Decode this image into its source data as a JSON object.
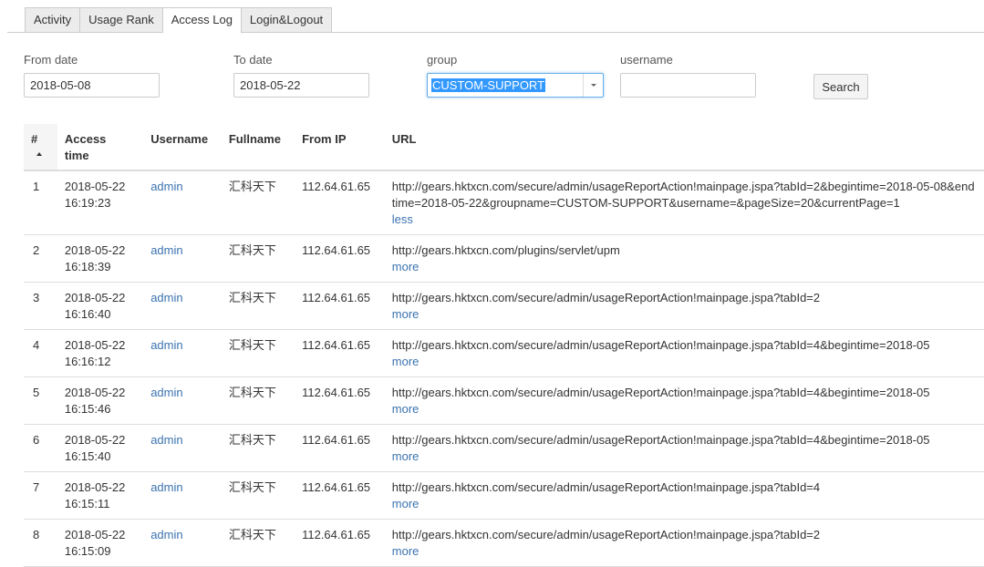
{
  "tabs": [
    {
      "label": "Activity",
      "active": false
    },
    {
      "label": "Usage Rank",
      "active": false
    },
    {
      "label": "Access Log",
      "active": true
    },
    {
      "label": "Login&Logout",
      "active": false
    }
  ],
  "filters": {
    "from_date": {
      "label": "From date",
      "value": "2018-05-08"
    },
    "to_date": {
      "label": "To date",
      "value": "2018-05-22"
    },
    "group": {
      "label": "group",
      "value": "CUSTOM-SUPPORT"
    },
    "username": {
      "label": "username",
      "value": "",
      "placeholder": ""
    },
    "search_label": "Search"
  },
  "table": {
    "columns": [
      "#",
      "Access time",
      "Username",
      "Fullname",
      "From IP",
      "URL"
    ],
    "column_time_lines": [
      "Access",
      "time"
    ],
    "sort": {
      "column": "#",
      "direction": "asc"
    },
    "rows": [
      {
        "num": "1",
        "date": "2018-05-22",
        "time": "16:19:23",
        "username": "admin",
        "fullname": "汇科天下",
        "ip": "112.64.61.65",
        "url": "http://gears.hktxcn.com/secure/admin/usageReportAction!mainpage.jspa?tabId=2&begintime=2018-05-08&endtime=2018-05-22&groupname=CUSTOM-SUPPORT&username=&pageSize=20&currentPage=1",
        "toggle": "less"
      },
      {
        "num": "2",
        "date": "2018-05-22",
        "time": "16:18:39",
        "username": "admin",
        "fullname": "汇科天下",
        "ip": "112.64.61.65",
        "url": "http://gears.hktxcn.com/plugins/servlet/upm",
        "toggle": "more"
      },
      {
        "num": "3",
        "date": "2018-05-22",
        "time": "16:16:40",
        "username": "admin",
        "fullname": "汇科天下",
        "ip": "112.64.61.65",
        "url": "http://gears.hktxcn.com/secure/admin/usageReportAction!mainpage.jspa?tabId=2",
        "toggle": "more"
      },
      {
        "num": "4",
        "date": "2018-05-22",
        "time": "16:16:12",
        "username": "admin",
        "fullname": "汇科天下",
        "ip": "112.64.61.65",
        "url": "http://gears.hktxcn.com/secure/admin/usageReportAction!mainpage.jspa?tabId=4&begintime=2018-05-",
        "toggle": "more"
      },
      {
        "num": "5",
        "date": "2018-05-22",
        "time": "16:15:46",
        "username": "admin",
        "fullname": "汇科天下",
        "ip": "112.64.61.65",
        "url": "http://gears.hktxcn.com/secure/admin/usageReportAction!mainpage.jspa?tabId=4&begintime=2018-05-",
        "toggle": "more"
      },
      {
        "num": "6",
        "date": "2018-05-22",
        "time": "16:15:40",
        "username": "admin",
        "fullname": "汇科天下",
        "ip": "112.64.61.65",
        "url": "http://gears.hktxcn.com/secure/admin/usageReportAction!mainpage.jspa?tabId=4&begintime=2018-05-",
        "toggle": "more"
      },
      {
        "num": "7",
        "date": "2018-05-22",
        "time": "16:15:11",
        "username": "admin",
        "fullname": "汇科天下",
        "ip": "112.64.61.65",
        "url": "http://gears.hktxcn.com/secure/admin/usageReportAction!mainpage.jspa?tabId=4",
        "toggle": "more"
      },
      {
        "num": "8",
        "date": "2018-05-22",
        "time": "16:15:09",
        "username": "admin",
        "fullname": "汇科天下",
        "ip": "112.64.61.65",
        "url": "http://gears.hktxcn.com/secure/admin/usageReportAction!mainpage.jspa?tabId=2",
        "toggle": "more"
      }
    ]
  },
  "colors": {
    "link": "#3b73af",
    "selection": "#3399ff",
    "focus_border": "#66afe9"
  }
}
